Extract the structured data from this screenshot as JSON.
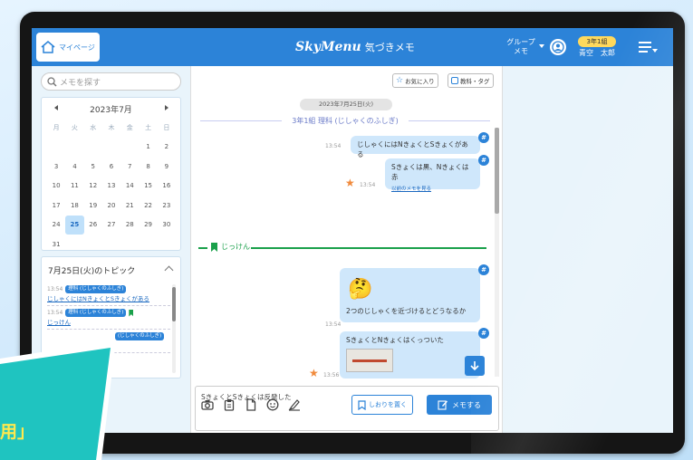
{
  "header": {
    "mypage_label": "マイページ",
    "brand": "SkyMenu",
    "app_title": "気づきメモ",
    "group_memo_line1": "グループ",
    "group_memo_line2": "メモ",
    "class_badge": "3年1組",
    "user_name": "青空　太郎"
  },
  "sidebar": {
    "search_placeholder": "メモを探す",
    "calendar": {
      "month_label": "2023年7月",
      "weekdays": [
        "月",
        "火",
        "水",
        "木",
        "金",
        "土",
        "日"
      ],
      "selected_day": "25",
      "days": [
        "",
        "",
        "",
        "",
        "",
        "1",
        "2",
        "3",
        "4",
        "5",
        "6",
        "7",
        "8",
        "9",
        "10",
        "11",
        "12",
        "13",
        "14",
        "15",
        "16",
        "17",
        "18",
        "19",
        "20",
        "21",
        "22",
        "23",
        "24",
        "25",
        "26",
        "27",
        "28",
        "29",
        "30",
        "31"
      ]
    },
    "topics": {
      "title": "7月25日(火)のトピック",
      "items": [
        {
          "time": "13:54",
          "badge": "理科 (じしゃくのふしぎ)",
          "text": "じしゃくにはNきょくとSきょくがある"
        },
        {
          "time": "13:54",
          "badge": "理科 (じしゃくのふしぎ)",
          "text": "じっけん"
        },
        {
          "time": "",
          "badge": "(じしゃくのふしぎ)",
          "text": ""
        }
      ]
    }
  },
  "chat": {
    "favorites_label": "お気に入り",
    "subject_tag_label": "教科・タグ",
    "date_pill": "2023年7月25日(火)",
    "class_topic": "3年1組 理科 (じしゃくのふしぎ)",
    "messages": [
      {
        "time": "13:54",
        "text": "じしゃくにはNきょくとSきょくがある"
      },
      {
        "time": "13:54",
        "text": "Sきょくは黒、Nきょくは赤",
        "link": "以前のメモを見る"
      },
      {
        "time": "13:54",
        "text": "2つのじしゃくを近づけるとどうなるか",
        "emoji": "🤔"
      },
      {
        "time": "13:56",
        "text": "SきょくとNきょくはくっついた"
      }
    ],
    "jikken_label": "じっけん",
    "input_value": "SきょくとSきょくは反発した",
    "bookmark_label": "しおりを置く",
    "memo_label": "メモする"
  },
  "banner": {
    "text": "用」"
  },
  "colors": {
    "primary": "#2c83d8",
    "green": "#1aa04b",
    "badge": "#ffd95c",
    "star": "#f08a3c"
  }
}
